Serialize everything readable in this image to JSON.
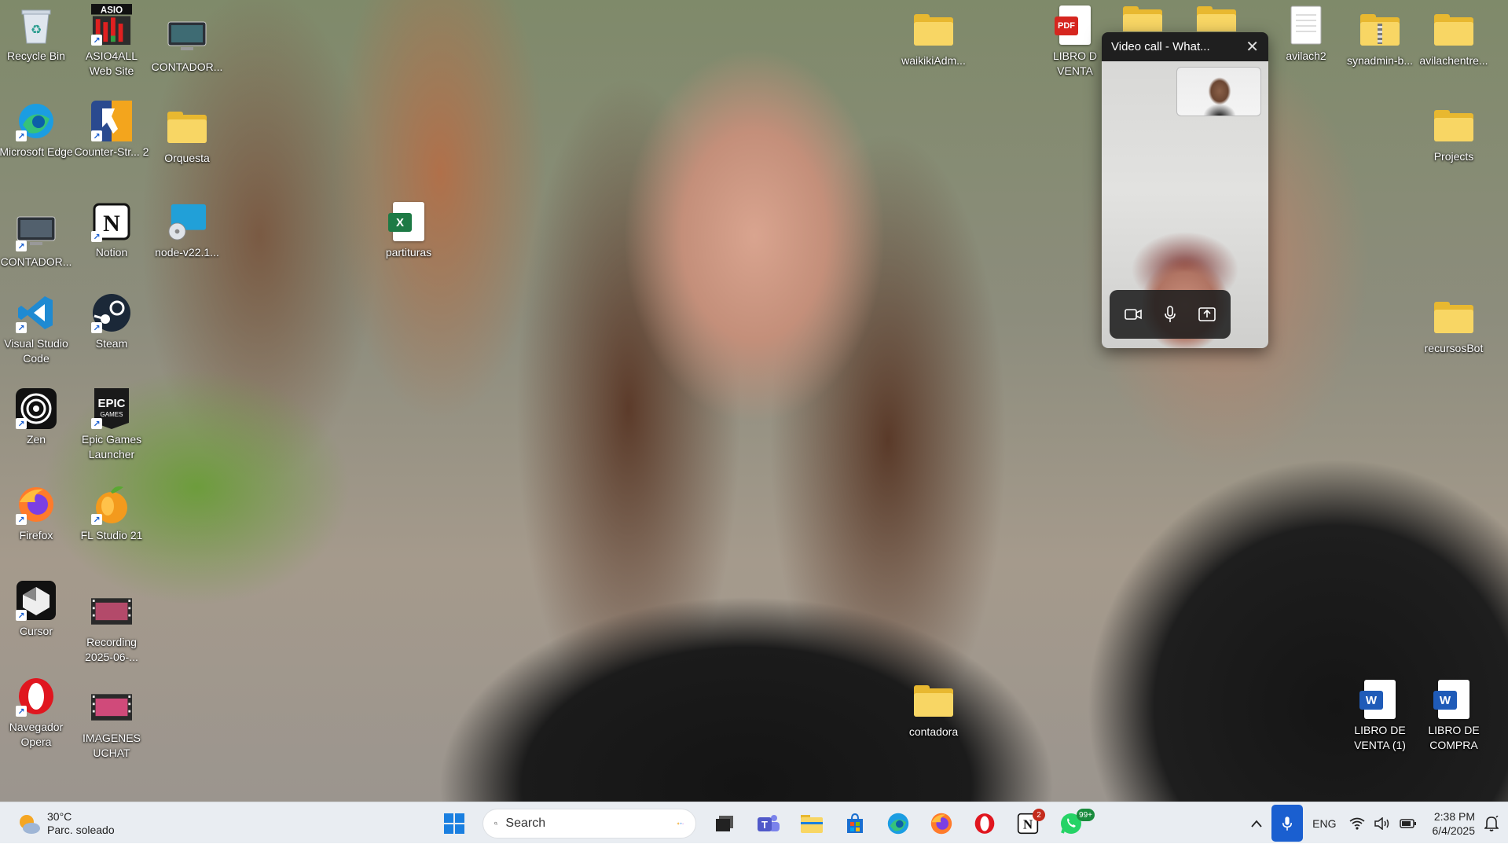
{
  "desktop": {
    "icons": [
      {
        "id": "recycle-bin",
        "label": "Recycle Bin",
        "icon": "recycle-bin-icon"
      },
      {
        "id": "asio4all",
        "label": "ASIO4ALL Web Site",
        "icon": "asio4all-icon",
        "logo_text": "ASIO"
      },
      {
        "id": "contador-1",
        "label": "CONTADOR...",
        "icon": "monitor-app-icon"
      },
      {
        "id": "edge",
        "label": "Microsoft Edge",
        "icon": "edge-icon"
      },
      {
        "id": "counter-strike",
        "label": "Counter-Str... 2",
        "icon": "counter-strike-icon"
      },
      {
        "id": "orquesta",
        "label": "Orquesta",
        "icon": "folder-icon"
      },
      {
        "id": "contador-2",
        "label": "CONTADOR...",
        "icon": "monitor-app-icon"
      },
      {
        "id": "notion",
        "label": "Notion",
        "icon": "notion-icon"
      },
      {
        "id": "node",
        "label": "node-v22.1...",
        "icon": "installer-icon"
      },
      {
        "id": "partituras",
        "label": "partituras",
        "icon": "excel-icon"
      },
      {
        "id": "vscode",
        "label": "Visual Studio Code",
        "icon": "vscode-icon"
      },
      {
        "id": "steam",
        "label": "Steam",
        "icon": "steam-icon"
      },
      {
        "id": "zen",
        "label": "Zen",
        "icon": "zen-icon"
      },
      {
        "id": "epic",
        "label": "Epic Games Launcher",
        "icon": "epic-games-icon",
        "logo_text": "EPIC GAMES"
      },
      {
        "id": "firefox",
        "label": "Firefox",
        "icon": "firefox-icon"
      },
      {
        "id": "flstudio",
        "label": "FL Studio 21",
        "icon": "fl-studio-icon"
      },
      {
        "id": "cursor",
        "label": "Cursor",
        "icon": "cursor-icon"
      },
      {
        "id": "recording",
        "label": "Recording 2025-06-...",
        "icon": "video-file-icon"
      },
      {
        "id": "opera",
        "label": "Navegador Opera",
        "icon": "opera-icon"
      },
      {
        "id": "imagenes",
        "label": "IMAGENES UCHAT",
        "icon": "video-file-icon"
      },
      {
        "id": "waikiki",
        "label": "waikikiAdm...",
        "icon": "folder-icon"
      },
      {
        "id": "libro-venta-pdf",
        "label": "LIBRO D VENTA",
        "icon": "pdf-icon",
        "badge": "PDF"
      },
      {
        "id": "avilach2",
        "label": "avilach2",
        "icon": "text-file-icon"
      },
      {
        "id": "synadmin",
        "label": "synadmin-b...",
        "icon": "zip-folder-icon"
      },
      {
        "id": "avilachentre",
        "label": "avilachentre...",
        "icon": "folder-icon"
      },
      {
        "id": "projects",
        "label": "Projects",
        "icon": "folder-icon"
      },
      {
        "id": "recursosbot",
        "label": "recursosBot",
        "icon": "folder-icon"
      },
      {
        "id": "contadora",
        "label": "contadora",
        "icon": "folder-icon"
      },
      {
        "id": "libro-venta-1",
        "label": "LIBRO DE VENTA (1)",
        "icon": "word-icon"
      },
      {
        "id": "libro-compra",
        "label": "LIBRO DE COMPRA",
        "icon": "word-icon"
      }
    ]
  },
  "call": {
    "title": "Video call - What...",
    "close": "✕",
    "controls": [
      "camera-icon",
      "microphone-icon",
      "share-screen-icon"
    ]
  },
  "taskbar": {
    "weather": {
      "temp": "30°C",
      "condition": "Parc. soleado"
    },
    "search_placeholder": "Search",
    "apps": [
      {
        "name": "start",
        "icon": "windows-start-icon"
      },
      {
        "name": "task-view",
        "icon": "task-view-icon"
      },
      {
        "name": "teams",
        "icon": "teams-icon"
      },
      {
        "name": "file-explorer",
        "icon": "file-explorer-icon"
      },
      {
        "name": "store",
        "icon": "microsoft-store-icon"
      },
      {
        "name": "edge",
        "icon": "edge-icon"
      },
      {
        "name": "firefox",
        "icon": "firefox-icon"
      },
      {
        "name": "opera",
        "icon": "opera-icon"
      },
      {
        "name": "notion",
        "icon": "notion-icon",
        "badge": "2"
      },
      {
        "name": "whatsapp",
        "icon": "whatsapp-icon",
        "badge": "99+"
      }
    ],
    "tray": {
      "language": "ENG",
      "time": "2:38 PM",
      "date": "6/4/2025"
    }
  },
  "colors": {
    "accent": "#1a5fd0",
    "folder": "#f8d664",
    "taskbar_bg": "#e9edf2"
  }
}
